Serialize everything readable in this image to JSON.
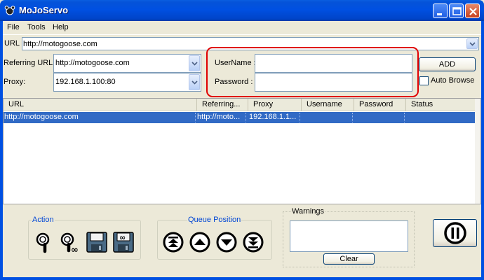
{
  "window": {
    "title": "MoJoServo"
  },
  "menu": [
    "File",
    "Tools",
    "Help"
  ],
  "url_field": {
    "label": "URL :",
    "value": "http://motogoose.com"
  },
  "referring": {
    "label": "Referring URL:",
    "value": "http://motogoose.com"
  },
  "proxy": {
    "label": "Proxy:",
    "value": "192.168.1.100:80"
  },
  "credentials": {
    "username_label": "UserName :",
    "username_value": "",
    "password_label": "Password :",
    "password_value": ""
  },
  "add_button": "ADD",
  "auto_browse": {
    "label": "Auto Browse",
    "checked": false
  },
  "table": {
    "columns": [
      "URL",
      "Referring...",
      "Proxy",
      "Username",
      "Password",
      "Status"
    ],
    "rows": [
      {
        "url": "http://motogoose.com",
        "referring": "http://moto...",
        "proxy": "192.168.1.1...",
        "username": "",
        "password": "",
        "status": "",
        "selected": true
      }
    ]
  },
  "action_group": {
    "legend": "Action",
    "icons": [
      "inspect-icon",
      "inspect-all-icon",
      "save-icon",
      "save-all-icon"
    ]
  },
  "queue_group": {
    "legend": "Queue Position",
    "icons": [
      "move-top-icon",
      "move-up-icon",
      "move-down-icon",
      "move-bottom-icon"
    ]
  },
  "warnings": {
    "legend": "Warnings",
    "text": "",
    "clear_label": "Clear"
  },
  "pause_button": {
    "icon": "pause-icon"
  },
  "colors": {
    "titlebar": "#0050e2",
    "selection": "#316ac5",
    "highlight_box": "#e00000",
    "legend": "#0046d5"
  }
}
